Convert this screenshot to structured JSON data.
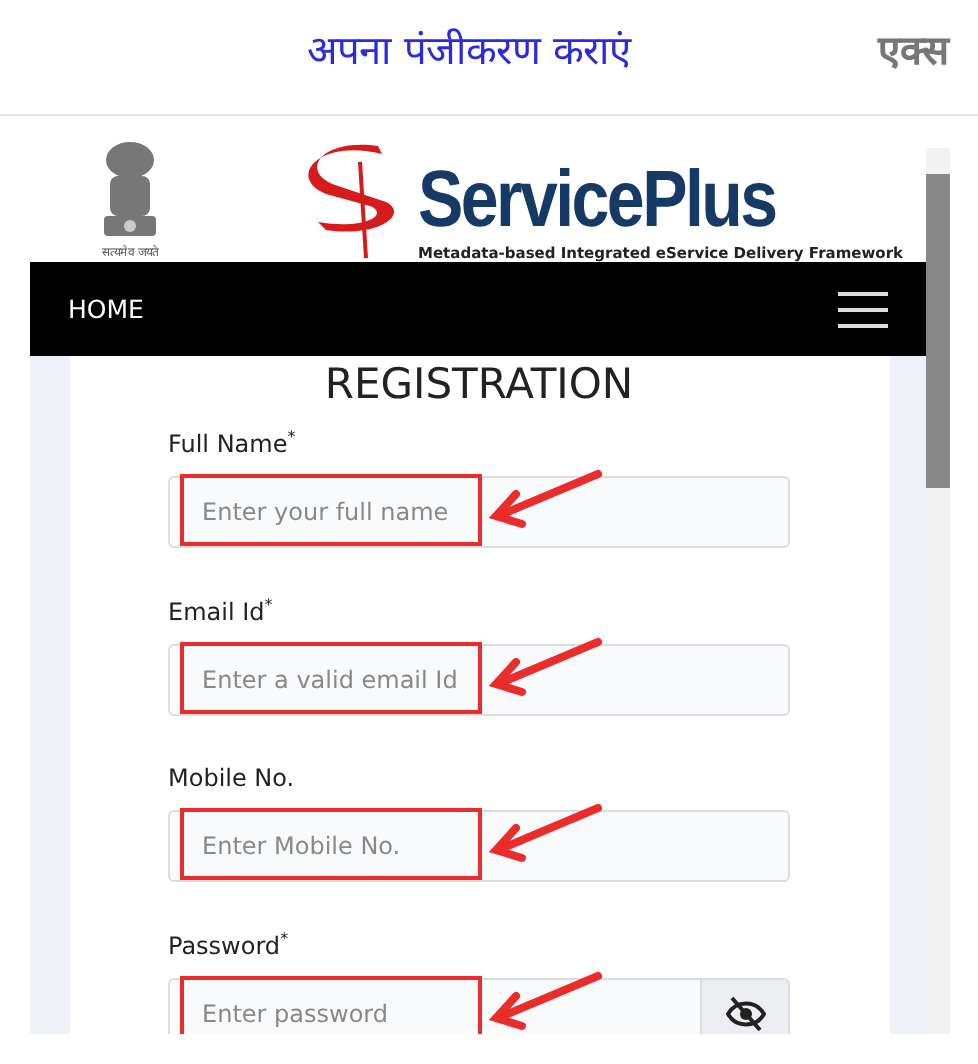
{
  "header": {
    "title": "अपना पंजीकरण कराएं",
    "close_label": "एक्स"
  },
  "site": {
    "emblem_motto": "सत्यमेव जयते",
    "brand": "ServicePlus",
    "tagline": "Metadata-based Integrated eService Delivery Framework"
  },
  "nav": {
    "home": "HOME"
  },
  "form": {
    "title": "REGISTRATION",
    "fields": [
      {
        "label": "Full Name$^{*}$",
        "placeholder": "Enter your full name",
        "kind": "text",
        "annotated": true
      },
      {
        "label": "Email Id$^{*}$",
        "placeholder": "Enter a valid email Id",
        "kind": "text",
        "annotated": true
      },
      {
        "label": "Mobile No.",
        "placeholder": "Enter Mobile No.",
        "kind": "text",
        "annotated": true
      },
      {
        "label": "Password$^{*}$",
        "placeholder": "Enter password",
        "kind": "password",
        "annotated": true
      }
    ]
  }
}
